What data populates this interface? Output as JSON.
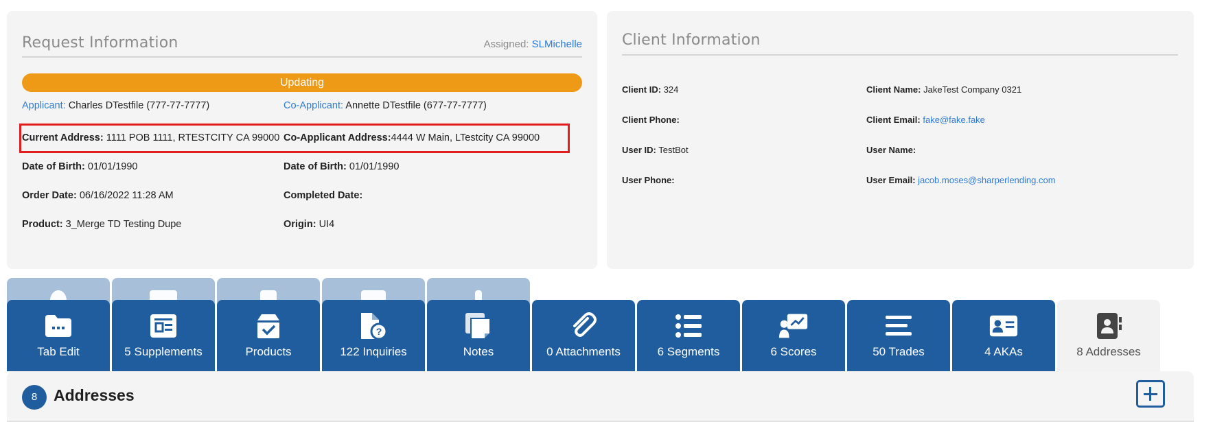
{
  "request": {
    "title": "Request Information",
    "assigned_label": "Assigned:",
    "assigned_value": "SLMichelle",
    "status": "Updating",
    "applicant_label": "Applicant:",
    "applicant_value": "Charles DTestfile (777-77-7777)",
    "coapplicant_label": "Co-Applicant:",
    "coapplicant_value": "Annette DTestfile (677-77-7777)",
    "current_address_label": "Current Address:",
    "current_address_value": "1111 POB 1111, RTESTCITY CA 99000",
    "coapplicant_address_label": "Co-Applicant Address:",
    "coapplicant_address_value": "4444 W Main, LTestcity CA 99000",
    "dob_label": "Date of Birth:",
    "dob_value": "01/01/1990",
    "co_dob_label": "Date of Birth:",
    "co_dob_value": "01/01/1990",
    "order_date_label": "Order Date:",
    "order_date_value": "06/16/2022 11:28 AM",
    "completed_date_label": "Completed Date:",
    "completed_date_value": "",
    "product_label": "Product:",
    "product_value": "3_Merge TD Testing Dupe",
    "origin_label": "Origin:",
    "origin_value": "UI4"
  },
  "client": {
    "title": "Client Information",
    "client_id_label": "Client ID:",
    "client_id_value": "324",
    "client_name_label": "Client Name:",
    "client_name_value": "JakeTest Company 0321",
    "client_phone_label": "Client Phone:",
    "client_phone_value": "",
    "client_email_label": "Client Email:",
    "client_email_value": "fake@fake.fake",
    "user_id_label": "User ID:",
    "user_id_value": "TestBot",
    "user_name_label": "User Name:",
    "user_name_value": "",
    "user_phone_label": "User Phone:",
    "user_phone_value": "",
    "user_email_label": "User Email:",
    "user_email_value": "jacob.moses@sharperlending.com"
  },
  "tabs": [
    {
      "label": "Tab Edit",
      "icon": "folder-icon"
    },
    {
      "label": "5 Supplements",
      "icon": "supplements-icon"
    },
    {
      "label": "Products",
      "icon": "box-check-icon"
    },
    {
      "label": "122 Inquiries",
      "icon": "file-question-icon"
    },
    {
      "label": "Notes",
      "icon": "notes-icon"
    },
    {
      "label": "0 Attachments",
      "icon": "paperclip-icon"
    },
    {
      "label": "6 Segments",
      "icon": "list-icon"
    },
    {
      "label": "6 Scores",
      "icon": "presentation-chart-icon"
    },
    {
      "label": "50 Trades",
      "icon": "lines-icon"
    },
    {
      "label": "4 AKAs",
      "icon": "id-card-icon"
    },
    {
      "label": "8 Addresses",
      "icon": "address-book-icon"
    }
  ],
  "active_tab": "8 Addresses",
  "addresses": {
    "count": "8",
    "title": "Addresses"
  },
  "colors": {
    "tab_blue": "#1f5d9e",
    "status_orange": "#ef9a17",
    "link_blue": "#2e7bd6",
    "highlight_red": "#e11d1d"
  }
}
